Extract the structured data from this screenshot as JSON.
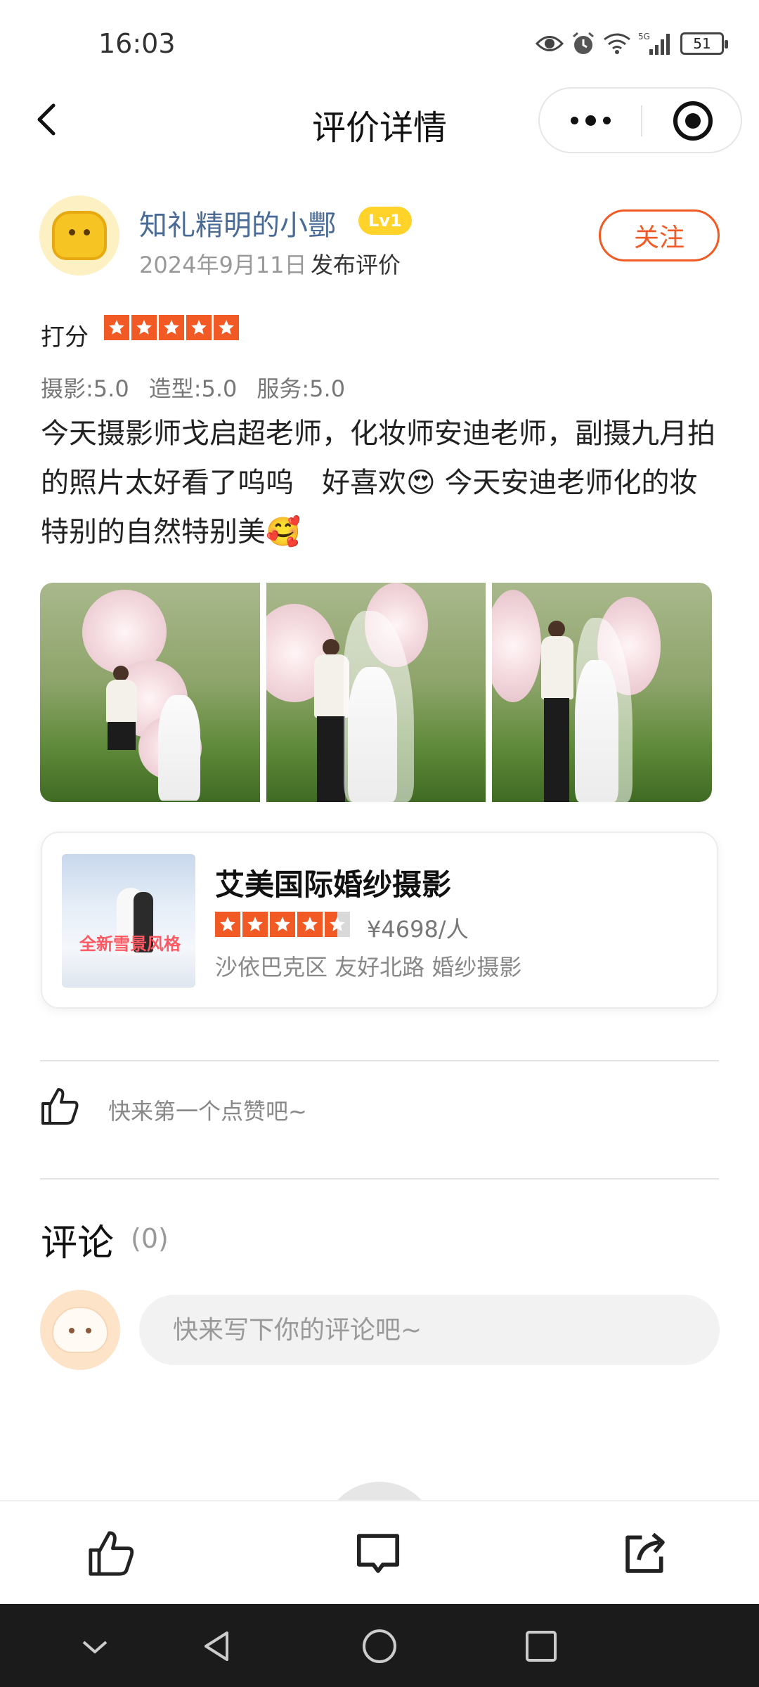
{
  "status_bar": {
    "time": "16:03",
    "battery": "51"
  },
  "nav": {
    "title": "评价详情"
  },
  "review": {
    "username": "知礼精明的小酆",
    "level": "Lv1",
    "date": "2024年9月11日",
    "action": "发布评价",
    "follow_label": "关注",
    "score_label": "打分",
    "overall_stars": 5,
    "sub_scores": [
      "摄影:5.0",
      "造型:5.0",
      "服务:5.0"
    ],
    "text": "今天摄影师戈启超老师，化妆师安迪老师，副摄九月拍的照片太好看了呜呜　好喜欢😍 今天安迪老师化的妆特别的自然特别美🥰"
  },
  "shop": {
    "name": "艾美国际婚纱摄影",
    "rating_stars": 4.5,
    "price": "¥4698/人",
    "meta": "沙依巴克区 友好北路 婚纱摄影",
    "thumb_text": "全新雪景风格"
  },
  "likes": {
    "hint": "快来第一个点赞吧~"
  },
  "comments": {
    "title": "评论",
    "count": "(0)",
    "input_placeholder": "快来写下你的评论吧~"
  },
  "colors": {
    "accent": "#f15a24",
    "username": "#4a6b95",
    "level_badge": "#ffd32a"
  },
  "icons": {
    "back": "chevron-left-icon",
    "more": "more-dots-icon",
    "close_target": "target-icon",
    "like": "thumbs-up-icon",
    "comment": "comment-icon",
    "share": "share-icon"
  }
}
